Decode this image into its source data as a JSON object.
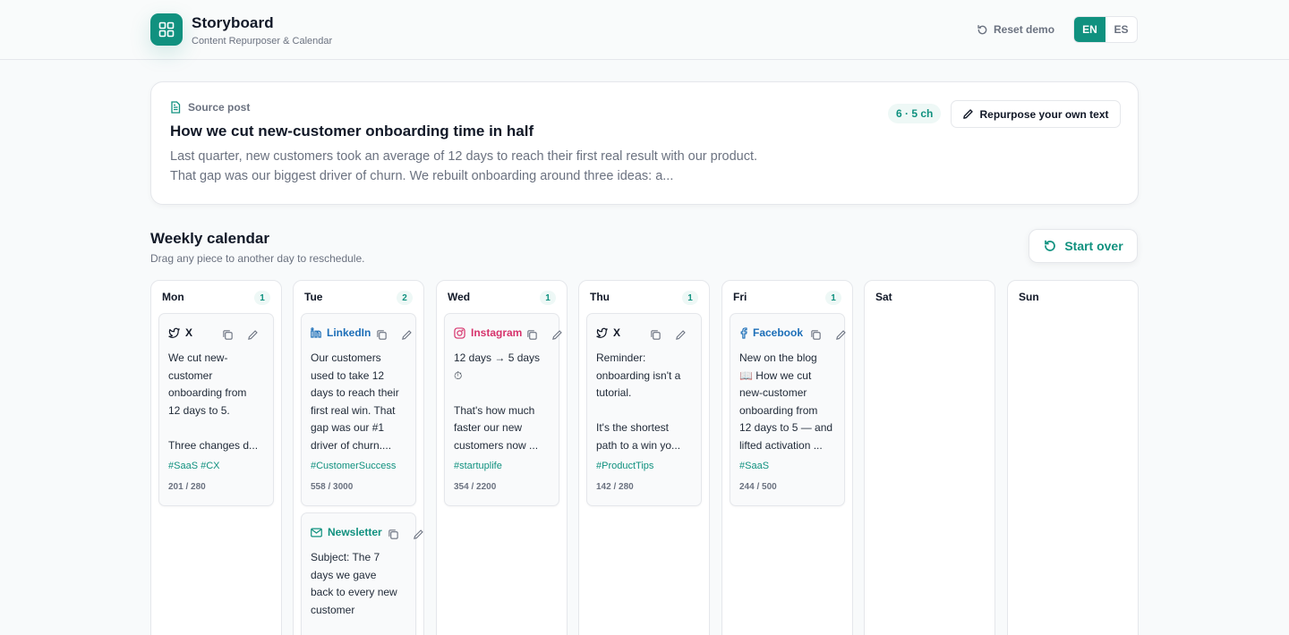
{
  "app": {
    "title": "Storyboard",
    "subtitle": "Content Repurposer & Calendar",
    "accent": "#10917f"
  },
  "header": {
    "reset_label": "Reset demo",
    "languages": [
      {
        "code": "EN",
        "active": true
      },
      {
        "code": "ES",
        "active": false
      }
    ]
  },
  "source": {
    "label": "Source post",
    "title": "How we cut new-customer onboarding time in half",
    "body": "Last quarter, new customers took an average of 12 days to reach their first real result with our product. That gap was our biggest driver of churn. We rebuilt onboarding around three ideas: a...",
    "meta": "6 · 5 ch",
    "repurpose_label": "Repurpose your own text"
  },
  "calendar": {
    "title": "Weekly calendar",
    "subtitle": "Drag any piece to another day to reschedule.",
    "start_over_label": "Start over",
    "days": [
      {
        "name": "Mon",
        "count": "1"
      },
      {
        "name": "Tue",
        "count": "2"
      },
      {
        "name": "Wed",
        "count": "1"
      },
      {
        "name": "Thu",
        "count": "1"
      },
      {
        "name": "Fri",
        "count": "1"
      },
      {
        "name": "Sat",
        "count": ""
      },
      {
        "name": "Sun",
        "count": ""
      }
    ]
  },
  "posts": {
    "mon": {
      "platform": "X",
      "icon": "x-icon",
      "color": "#111827",
      "text": "We cut new-\ncustomer\nonboarding from\n12 days to 5.\n\nThree changes d...",
      "tags": "#SaaS #CX",
      "chars": "201 / 280"
    },
    "tue1": {
      "platform": "LinkedIn",
      "icon": "linkedin-icon",
      "color": "#1d6fb8",
      "text": "Our customers\nused to take 12\ndays to reach their\nfirst real win. That\ngap was our #1\ndriver of churn....",
      "tags": "#CustomerSuccess",
      "chars": "558 / 3000"
    },
    "tue2": {
      "platform": "Newsletter",
      "icon": "mail-icon",
      "color": "#10917f",
      "text": "Subject: The 7\ndays we gave\nback to every new\ncustomer",
      "tags": "",
      "chars": ""
    },
    "wed": {
      "platform": "Instagram",
      "icon": "instagram-icon",
      "color": "#d6336c",
      "text": "12 days → 5 days\n⏱\n\nThat's how much\nfaster our new\ncustomers now ...",
      "tags": "#startuplife",
      "chars": "354 / 2200"
    },
    "thu": {
      "platform": "X",
      "icon": "x-icon",
      "color": "#111827",
      "text": "Reminder:\nonboarding isn't a\ntutorial.\n\nIt's the shortest\npath to a win yo...",
      "tags": "#ProductTips",
      "chars": "142 / 280"
    },
    "fri": {
      "platform": "Facebook",
      "icon": "facebook-icon",
      "color": "#1d6fb8",
      "text": "New on the blog\n📖 How we cut\nnew-customer\nonboarding from\n12 days to 5 — and\nlifted activation ...",
      "tags": "#SaaS",
      "chars": "244 / 500"
    }
  }
}
